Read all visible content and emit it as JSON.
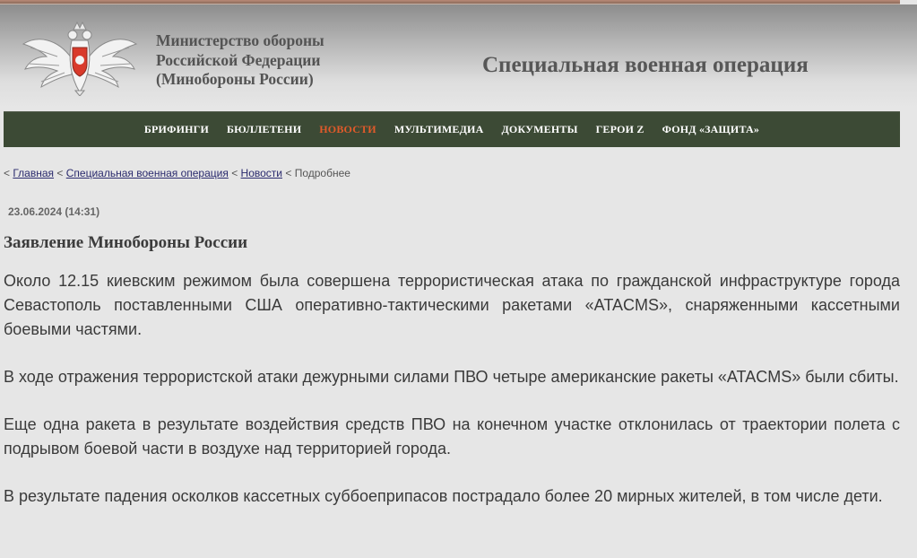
{
  "header": {
    "ministry_lines": [
      "Министерство обороны",
      "Российской Федерации",
      "(Минобороны России)"
    ],
    "section_title": "Специальная военная операция"
  },
  "nav": {
    "items": [
      {
        "label": "БРИФИНГИ",
        "active": false
      },
      {
        "label": "БЮЛЛЕТЕНИ",
        "active": false
      },
      {
        "label": "НОВОСТИ",
        "active": true
      },
      {
        "label": "МУЛЬТИМЕДИА",
        "active": false
      },
      {
        "label": "ДОКУМЕНТЫ",
        "active": false
      },
      {
        "label": "ГЕРОИ Z",
        "active": false
      },
      {
        "label": "ФОНД «ЗАЩИТА»",
        "active": false
      }
    ],
    "active_color": "#e15a2a",
    "background_color": "#3c4a35"
  },
  "breadcrumb": {
    "separator": "<",
    "links": [
      "Главная",
      "Специальная военная операция",
      "Новости"
    ],
    "current": "Подробнее"
  },
  "article": {
    "date": "23.06.2024 (14:31)",
    "title": "Заявление Минобороны России",
    "paragraphs": [
      "Около 12.15 киевским режимом была совершена террористическая атака по гражданской инфраструктуре города Севастополь поставленными США оперативно-тактическими ракетами «ATACMS», снаряженными кассетными боевыми частями.",
      "В ходе отражения террористской атаки дежурными силами ПВО четыре американские ракеты «ATACMS» были сбиты.",
      "Еще одна ракета в результате воздействия средств ПВО на конечном участке отклонилась от траектории полета с подрывом боевой части в воздухе над территорией города.",
      "В результате падения осколков кассетных суббоеприпасов пострадало более 20 мирных жителей, в том числе дети."
    ]
  },
  "icons": {
    "emblem": "double-headed-eagle-emblem-icon"
  }
}
